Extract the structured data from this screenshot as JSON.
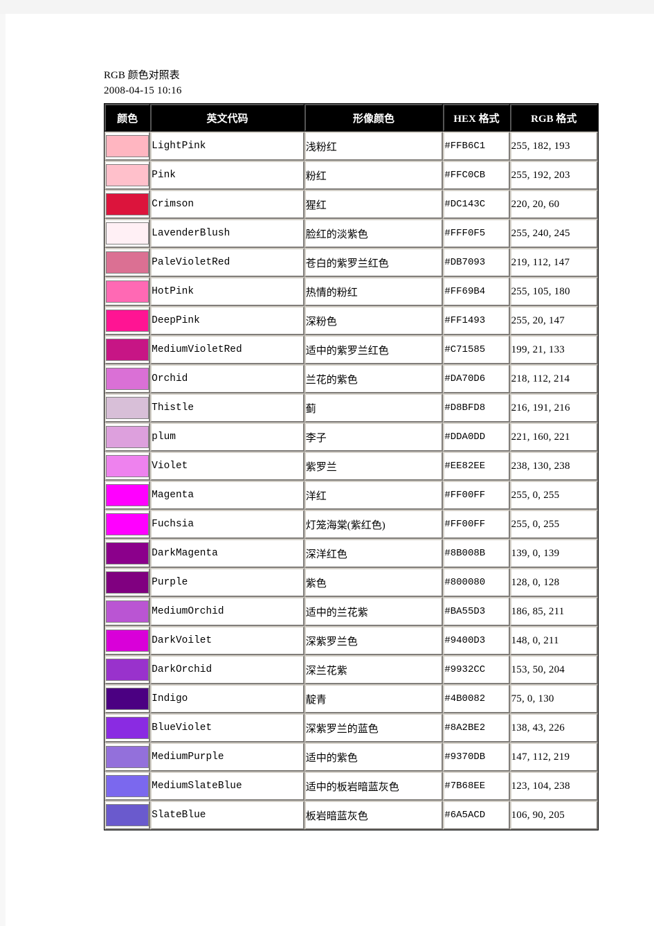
{
  "document": {
    "title": "RGB 颜色对照表",
    "date": "2008-04-15  10:16"
  },
  "table": {
    "headers": {
      "swatch": "颜色",
      "english_code": "英文代码",
      "image_color": "形像颜色",
      "hex_format": "HEX 格式",
      "rgb_format": "RGB 格式"
    },
    "rows": [
      {
        "name": "LightPink",
        "cn": "浅粉红",
        "hex": "#FFB6C1",
        "rgb": "255, 182, 193",
        "swatch": "#FFB6C1"
      },
      {
        "name": "Pink",
        "cn": "粉红",
        "hex": "#FFC0CB",
        "rgb": "255, 192, 203",
        "swatch": "#FFC0CB"
      },
      {
        "name": "Crimson",
        "cn": "猩红",
        "hex": "#DC143C",
        "rgb": "220, 20, 60",
        "swatch": "#DC143C"
      },
      {
        "name": "LavenderBlush",
        "cn": "脸红的淡紫色",
        "hex": "#FFF0F5",
        "rgb": "255, 240, 245",
        "swatch": "#FFF0F5"
      },
      {
        "name": "PaleVioletRed",
        "cn": "苍白的紫罗兰红色",
        "hex": "#DB7093",
        "rgb": "219, 112, 147",
        "swatch": "#DB7093"
      },
      {
        "name": "HotPink",
        "cn": "热情的粉红",
        "hex": "#FF69B4",
        "rgb": "255, 105, 180",
        "swatch": "#FF69B4"
      },
      {
        "name": "DeepPink",
        "cn": "深粉色",
        "hex": "#FF1493",
        "rgb": "255, 20, 147",
        "swatch": "#FF1493"
      },
      {
        "name": "MediumVioletRed",
        "cn": "适中的紫罗兰红色",
        "hex": "#C71585",
        "rgb": "199, 21, 133",
        "swatch": "#C71585"
      },
      {
        "name": "Orchid",
        "cn": "兰花的紫色",
        "hex": "#DA70D6",
        "rgb": "218, 112, 214",
        "swatch": "#DA70D6"
      },
      {
        "name": "Thistle",
        "cn": "蓟",
        "hex": "#D8BFD8",
        "rgb": "216, 191, 216",
        "swatch": "#D8BFD8"
      },
      {
        "name": "plum",
        "cn": "李子",
        "hex": "#DDA0DD",
        "rgb": "221, 160, 221",
        "swatch": "#DDA0DD"
      },
      {
        "name": "Violet",
        "cn": "紫罗兰",
        "hex": "#EE82EE",
        "rgb": "238, 130, 238",
        "swatch": "#EE82EE"
      },
      {
        "name": "Magenta",
        "cn": "洋红",
        "hex": "#FF00FF",
        "rgb": "255, 0, 255",
        "swatch": "#FF00FF"
      },
      {
        "name": "Fuchsia",
        "cn": "灯笼海棠(紫红色)",
        "hex": "#FF00FF",
        "rgb": "255, 0, 255",
        "swatch": "#FF00FF"
      },
      {
        "name": "DarkMagenta",
        "cn": "深洋红色",
        "hex": "#8B008B",
        "rgb": "139, 0, 139",
        "swatch": "#8B008B"
      },
      {
        "name": "Purple",
        "cn": "紫色",
        "hex": "#800080",
        "rgb": "128, 0, 128",
        "swatch": "#800080"
      },
      {
        "name": "MediumOrchid",
        "cn": "适中的兰花紫",
        "hex": "#BA55D3",
        "rgb": "186, 85, 211",
        "swatch": "#BA55D3"
      },
      {
        "name": "DarkVoilet",
        "cn": "深紫罗兰色",
        "hex": "#9400D3",
        "rgb": "148, 0, 211",
        "swatch": "#D900D9"
      },
      {
        "name": "DarkOrchid",
        "cn": "深兰花紫",
        "hex": "#9932CC",
        "rgb": "153, 50, 204",
        "swatch": "#9932CC"
      },
      {
        "name": "Indigo",
        "cn": "靛青",
        "hex": "#4B0082",
        "rgb": "75, 0, 130",
        "swatch": "#4B0082"
      },
      {
        "name": "BlueViolet",
        "cn": "深紫罗兰的蓝色",
        "hex": "#8A2BE2",
        "rgb": "138, 43, 226",
        "swatch": "#8A2BE2"
      },
      {
        "name": "MediumPurple",
        "cn": "适中的紫色",
        "hex": "#9370DB",
        "rgb": "147, 112, 219",
        "swatch": "#9370DB"
      },
      {
        "name": "MediumSlateBlue",
        "cn": "适中的板岩暗蓝灰色",
        "hex": "#7B68EE",
        "rgb": "123, 104, 238",
        "swatch": "#7B68EE"
      },
      {
        "name": "SlateBlue",
        "cn": "板岩暗蓝灰色",
        "hex": "#6A5ACD",
        "rgb": "106, 90, 205",
        "swatch": "#6A5ACD"
      }
    ]
  }
}
